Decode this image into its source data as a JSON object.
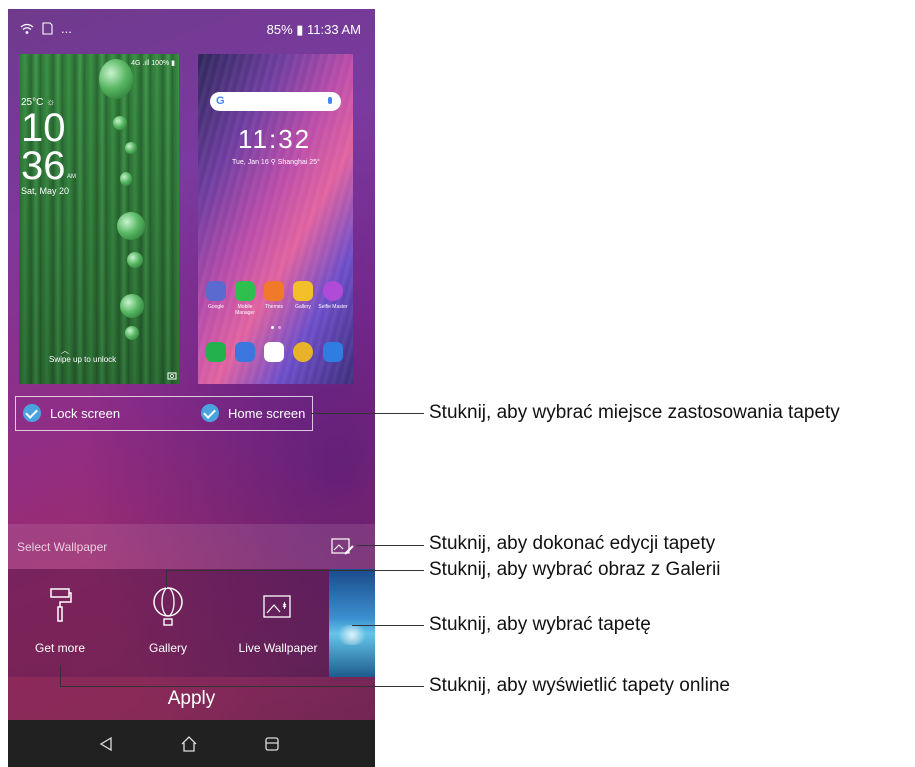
{
  "status_bar": {
    "battery_time": "85% ▮ 11:33 AM",
    "more": "..."
  },
  "lock_preview": {
    "status": "4G .ıll 100% ▮",
    "temperature": "25°C ☼",
    "hour": "10",
    "minute": "36",
    "am": "AM",
    "date": "Sat, May 20",
    "swipe": "Swipe up to unlock"
  },
  "home_preview": {
    "clock": "11:32",
    "date_line": "Tue, Jan 16  ⚲ Shanghai  25°",
    "apps": [
      {
        "label": "Google",
        "color": "#5a6acf"
      },
      {
        "label": "Mobile Manager",
        "color": "#2fbf4f"
      },
      {
        "label": "Themes",
        "color": "#f07a2a"
      },
      {
        "label": "Gallery",
        "color": "#f3c02a"
      },
      {
        "label": "Selfie Master",
        "color": "#b04ad8"
      }
    ],
    "dock": [
      {
        "color": "#22b14c"
      },
      {
        "color": "#3a78e0"
      },
      {
        "color": "#ffffff"
      },
      {
        "color": "#e8b32a"
      },
      {
        "color": "#2f7de0"
      }
    ]
  },
  "targets": {
    "lock": "Lock screen",
    "home": "Home screen"
  },
  "select_label": "Select Wallpaper",
  "tiles": {
    "get_more": "Get more",
    "gallery": "Gallery",
    "live": "Live Wallpaper"
  },
  "apply_label": "Apply",
  "callouts": {
    "c1": "Stuknij, aby wybrać miejsce zastosowania tapety",
    "c2": "Stuknij, aby dokonać edycji tapety",
    "c3": "Stuknij, aby wybrać obraz z Galerii",
    "c4": "Stuknij, aby wybrać tapetę",
    "c5": "Stuknij, aby wyświetlić tapety online"
  },
  "colors": {
    "accent_check": "#4aa3df",
    "navbar": "#212121"
  }
}
